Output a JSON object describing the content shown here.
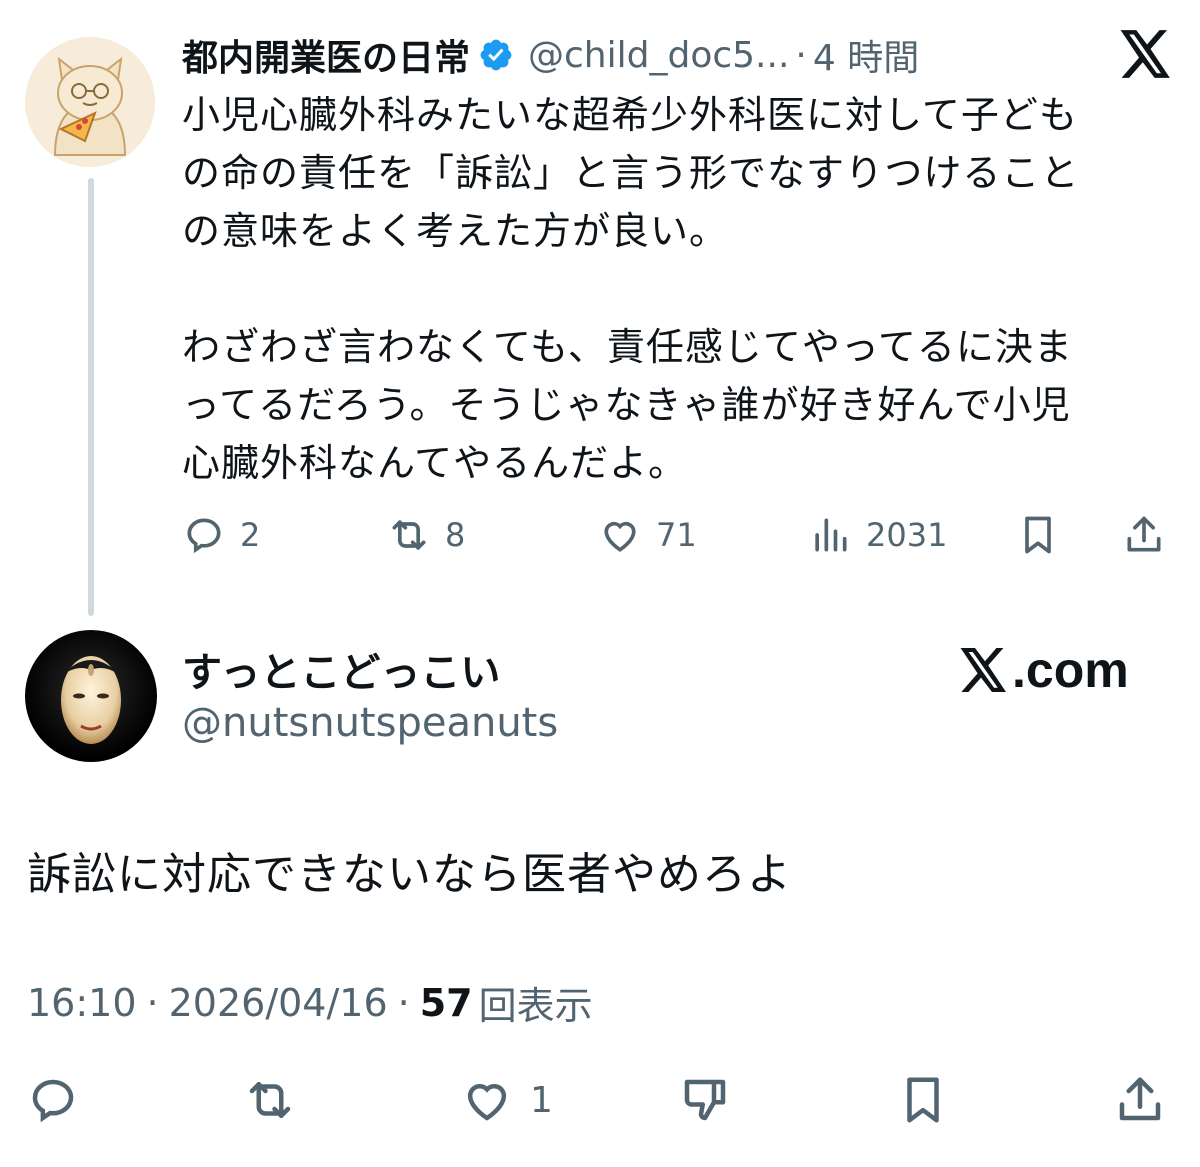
{
  "tweet": {
    "author_name": "都内開業医の日常",
    "author_handle": "@child_doc5...",
    "separator": "·",
    "time_ago": "4 時間",
    "body_lines_p1": [
      "小児心臓外科みたいな超希少外科医に対して子ども",
      "の命の責任を「訴訟」と言う形でなすりつけること",
      "の意味をよく考えた方が良い。"
    ],
    "body_lines_p2": [
      "わざわざ言わなくても、責任感じてやってるに決ま",
      "ってるだろう。そうじゃなきゃ誰が好き好んで小児",
      "心臓外科なんてやるんだよ。"
    ],
    "actions": {
      "replies": "2",
      "reposts": "8",
      "likes": "71",
      "views": "2031"
    }
  },
  "reply": {
    "author_name": "すっとこどっこい",
    "author_handle": "@nutsnutspeanuts",
    "site_label": ".com",
    "body": "訴訟に対応できないなら医者やめろよ",
    "time": "16:10",
    "date": "2026/04/16",
    "views_count": "57",
    "views_label": "回表示",
    "dot": "·",
    "actions": {
      "likes": "1"
    }
  },
  "icons": {
    "top_right": "x-logo-icon",
    "verified": "verified-badge-icon",
    "reply": "reply-icon",
    "repost": "repost-icon",
    "like": "heart-icon",
    "views": "views-icon",
    "bookmark": "bookmark-icon",
    "share": "share-icon",
    "dislike": "dislike-icon"
  },
  "colors": {
    "text": "#0f1419",
    "secondary": "#536471",
    "verified": "#1d9bf0",
    "thread_line": "#cfd9de"
  }
}
